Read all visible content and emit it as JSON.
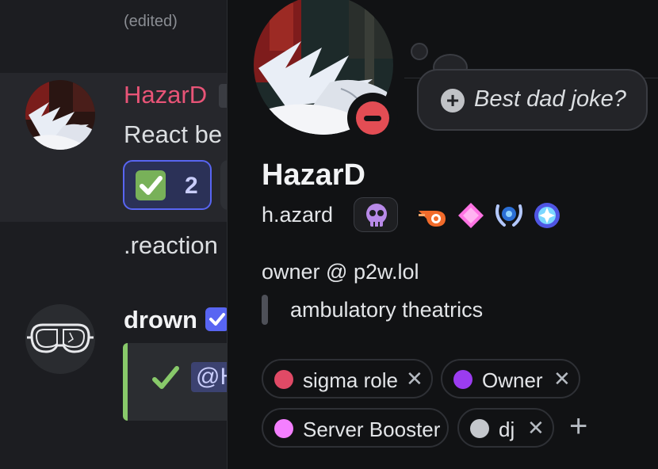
{
  "chat": {
    "edited_label": "(edited)",
    "message1": {
      "author": "HazarD",
      "text": "React be",
      "author_color": "#e85477"
    },
    "reaction": {
      "emoji": "white-check-mark",
      "count": "2"
    },
    "message2_text": ".reaction",
    "message3": {
      "author": "drown",
      "mention": "@H"
    }
  },
  "profile": {
    "status": "do-not-disturb",
    "custom_status": "Best dad joke?",
    "display_name": "HazarD",
    "username": "h.azard",
    "badges": [
      "skull-badge",
      "nitro-boost-badge",
      "diamond-badge",
      "laurel-badge",
      "quest-badge"
    ],
    "bio_line1": "owner @ p2w.lol",
    "bio_quote": "ambulatory theatrics",
    "roles": [
      {
        "name": "sigma role",
        "color": "#e04a66",
        "removable": true
      },
      {
        "name": "Owner",
        "color": "#9b3cf0",
        "removable": true
      },
      {
        "name": "Server Booster",
        "color": "#f47fff",
        "removable": false
      },
      {
        "name": "dj",
        "color": "#c4c7cc",
        "removable": true
      }
    ],
    "remove_symbol": "✕",
    "add_role_symbol": "+"
  }
}
